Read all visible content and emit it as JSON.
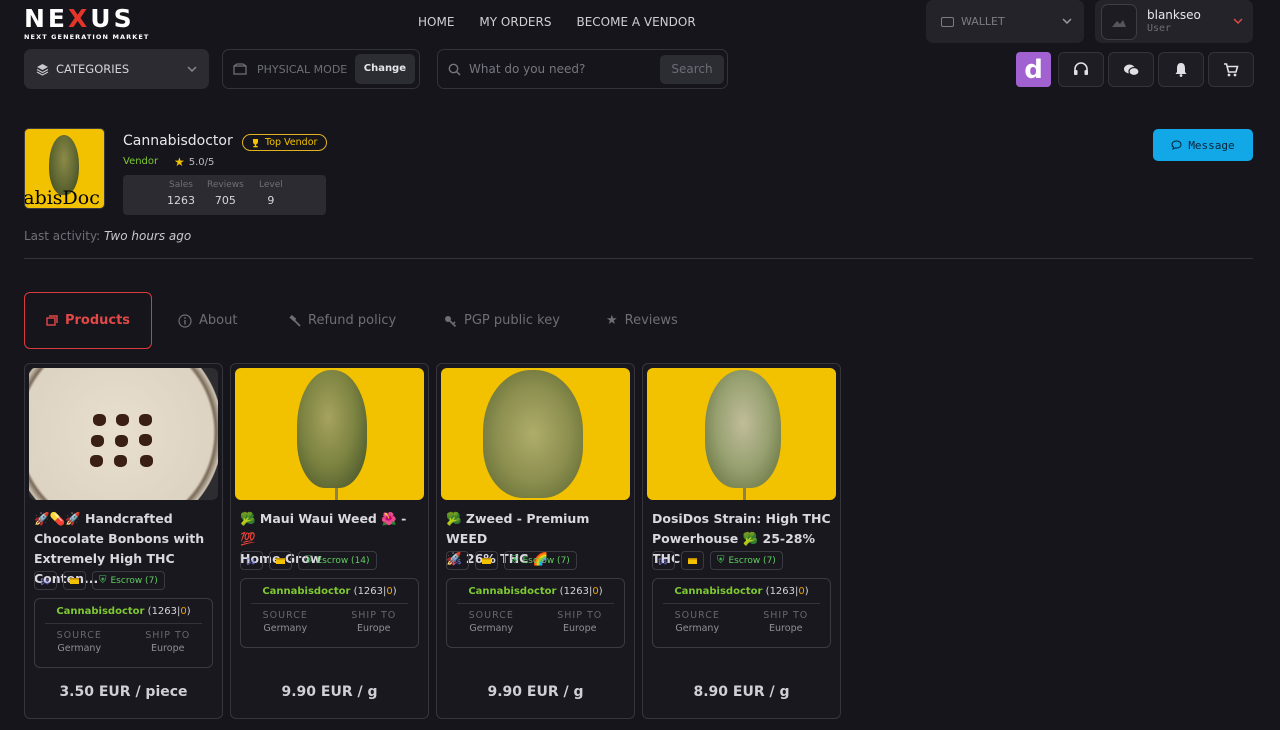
{
  "brand": {
    "name_pre": "NE",
    "name_x": "X",
    "name_post": "US",
    "tagline": "NEXT GENERATION MARKET"
  },
  "nav": {
    "home": "HOME",
    "orders": "MY ORDERS",
    "vendor": "BECOME A VENDOR"
  },
  "wallet": {
    "label": "WALLET"
  },
  "user": {
    "name": "blankseo",
    "role": "User"
  },
  "toolbar": {
    "categories": "CATEGORIES",
    "mode": "PHYSICAL MODE",
    "change": "Change",
    "search_placeholder": "What do you need?",
    "search_button": "Search",
    "d_button": "d"
  },
  "vendor": {
    "name": "Cannabisdoctor",
    "badge": "Top Vendor",
    "role": "Vendor",
    "rating": "5.0/5",
    "image_text": "nabisDoc",
    "stats": [
      {
        "label": "Sales",
        "value": "1263"
      },
      {
        "label": "Reviews",
        "value": "705"
      },
      {
        "label": "Level",
        "value": "9"
      }
    ],
    "last_activity_label": "Last activity:",
    "last_activity_value": "Two hours ago",
    "message_button": "Message"
  },
  "tabs": [
    {
      "label": "Products",
      "icon": "products-icon"
    },
    {
      "label": "About",
      "icon": "info-icon"
    },
    {
      "label": "Refund policy",
      "icon": "hammer-icon"
    },
    {
      "label": "PGP public key",
      "icon": "key-icon"
    },
    {
      "label": "Reviews",
      "icon": "star-icon"
    }
  ],
  "products": [
    {
      "title": "🚀💊🚀 Handcrafted\nChocolate Bonbons with\nExtremely High THC Conten...",
      "escrow": "Escrow (7)",
      "vendor": "Cannabisdoctor",
      "vendor_stats_a": "1263",
      "vendor_stats_b": "0",
      "source_label": "SOURCE",
      "source": "Germany",
      "ship_label": "SHIP TO",
      "ship": "Europe",
      "price": "3.50 EUR / piece"
    },
    {
      "title": "🥦 Maui Waui Weed 🌺 - 💯\nHome Grow",
      "escrow": "Escrow (14)",
      "vendor": "Cannabisdoctor",
      "vendor_stats_a": "1263",
      "vendor_stats_b": "0",
      "source_label": "SOURCE",
      "source": "Germany",
      "ship_label": "SHIP TO",
      "ship": "Europe",
      "price": "9.90 EUR / g"
    },
    {
      "title": "🥦 Zweed - Premium WEED\n🚀 26% THC 🌈",
      "escrow": "Escrow (7)",
      "vendor": "Cannabisdoctor",
      "vendor_stats_a": "1263",
      "vendor_stats_b": "0",
      "source_label": "SOURCE",
      "source": "Germany",
      "ship_label": "SHIP TO",
      "ship": "Europe",
      "price": "9.90 EUR / g"
    },
    {
      "title": "DosiDos Strain: High THC\nPowerhouse 🥦 25-28% THC",
      "escrow": "Escrow (7)",
      "vendor": "Cannabisdoctor",
      "vendor_stats_a": "1263",
      "vendor_stats_b": "0",
      "source_label": "SOURCE",
      "source": "Germany",
      "ship_label": "SHIP TO",
      "ship": "Europe",
      "price": "8.90 EUR / g"
    }
  ]
}
